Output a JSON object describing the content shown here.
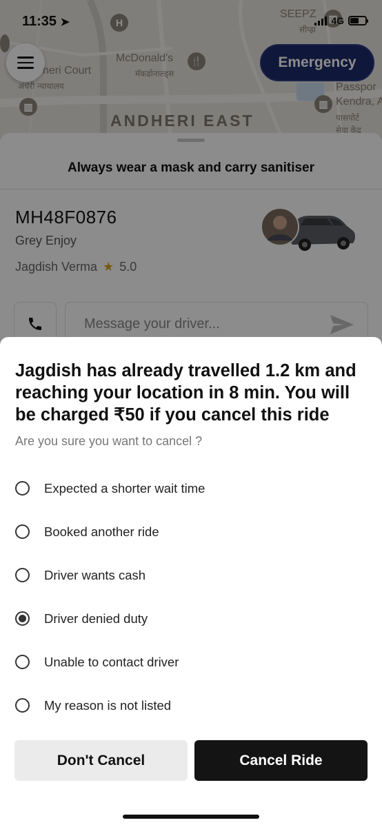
{
  "status_bar": {
    "time": "11:35",
    "network": "4G"
  },
  "map": {
    "labels": {
      "andheri_court_en": "heri Court",
      "andheri_court_hi": "अंधेरी न्यायालय",
      "mcdonalds_en": "McDonald's",
      "mcdonalds_hi": "मॅकडोनाल्ड्स",
      "area": "ANDHERI EAST",
      "seepz_en": "SEEPZ",
      "seepz_hi": "सीप्झ",
      "passport_en_1": "Passpor",
      "passport_en_2": "Kendra, A",
      "passport_hi_1": "पासपोर्ट",
      "passport_hi_2": "सेवा केंद्र"
    },
    "poi_hospital": "H"
  },
  "header": {
    "emergency_label": "Emergency"
  },
  "ride": {
    "notice": "Always wear a mask and carry sanitiser",
    "plate": "MH48F0876",
    "car_model": "Grey Enjoy",
    "driver_name": "Jagdish Verma",
    "rating": "5.0",
    "message_placeholder": "Message your driver..."
  },
  "cancel_dialog": {
    "title": "Jagdish has already travelled 1.2 km and reaching your location in 8 min. You will be charged ₹50 if you cancel this ride",
    "subtitle": "Are you sure you want to cancel ?",
    "reasons": [
      {
        "label": "Expected a shorter wait time",
        "selected": false
      },
      {
        "label": "Booked another ride",
        "selected": false
      },
      {
        "label": "Driver wants cash",
        "selected": false
      },
      {
        "label": "Driver denied duty",
        "selected": true
      },
      {
        "label": "Unable to contact driver",
        "selected": false
      },
      {
        "label": "My reason is not listed",
        "selected": false
      }
    ],
    "dont_cancel_label": "Don't Cancel",
    "cancel_label": "Cancel Ride"
  },
  "colors": {
    "emergency": "#1c2a6a",
    "primary_button": "#141414",
    "rating_star": "#d9a21b"
  }
}
